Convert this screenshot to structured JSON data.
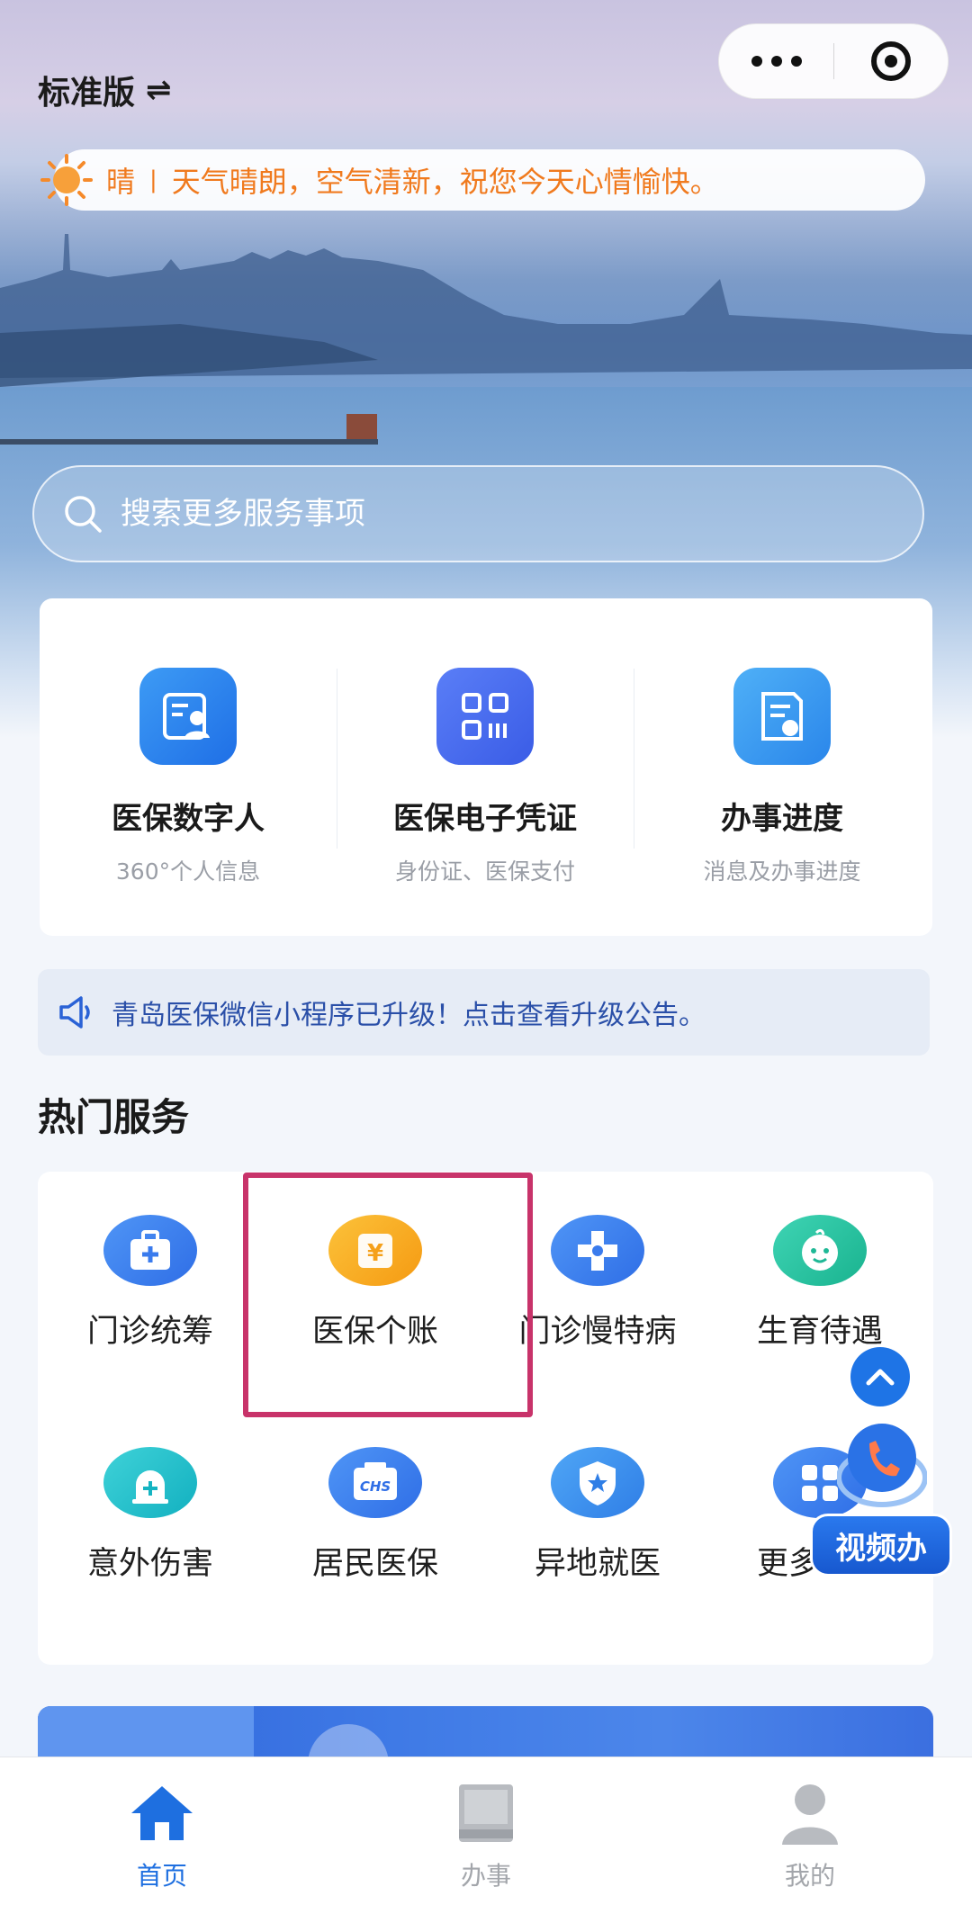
{
  "header": {
    "edition_label": "标准版",
    "swap_symbol": "⇌"
  },
  "weather": {
    "condition": "晴",
    "divider": "|",
    "message": "天气晴朗，空气清新，祝您今天心情愉快。",
    "icon": "sun-icon"
  },
  "search": {
    "placeholder": "搜索更多服务事项",
    "icon": "search-icon"
  },
  "quick_services": [
    {
      "title": "医保数字人",
      "subtitle": "360°个人信息",
      "icon": "profile-card-icon"
    },
    {
      "title": "医保电子凭证",
      "subtitle": "身份证、医保支付",
      "icon": "qr-code-icon"
    },
    {
      "title": "办事进度",
      "subtitle": "消息及办事进度",
      "icon": "progress-doc-icon"
    }
  ],
  "notice": {
    "text": "青岛医保微信小程序已升级！点击查看升级公告。",
    "icon": "speaker-icon"
  },
  "hot_services": {
    "title": "热门服务",
    "items": [
      {
        "label": "门诊统筹",
        "icon": "medical-kit-icon"
      },
      {
        "label": "医保个账",
        "icon": "yuan-account-icon"
      },
      {
        "label": "门诊慢特病",
        "icon": "medical-cross-icon"
      },
      {
        "label": "生育待遇",
        "icon": "baby-face-icon"
      },
      {
        "label": "意外伤害",
        "icon": "alarm-plus-icon"
      },
      {
        "label": "居民医保",
        "icon": "chs-card-icon"
      },
      {
        "label": "异地就医",
        "icon": "shield-star-icon"
      },
      {
        "label": "更多功能",
        "icon": "grid-icon"
      }
    ]
  },
  "floating": {
    "video_label": "视频办"
  },
  "tabbar": [
    {
      "label": "首页",
      "icon": "home-icon",
      "active": true
    },
    {
      "label": "办事",
      "icon": "book-icon",
      "active": false
    },
    {
      "label": "我的",
      "icon": "user-icon",
      "active": false
    }
  ],
  "colors": {
    "primary": "#1e6fe0",
    "weather_text": "#f07a1e",
    "highlight_border": "#c8336a",
    "notice_text": "#2a4fa8"
  }
}
